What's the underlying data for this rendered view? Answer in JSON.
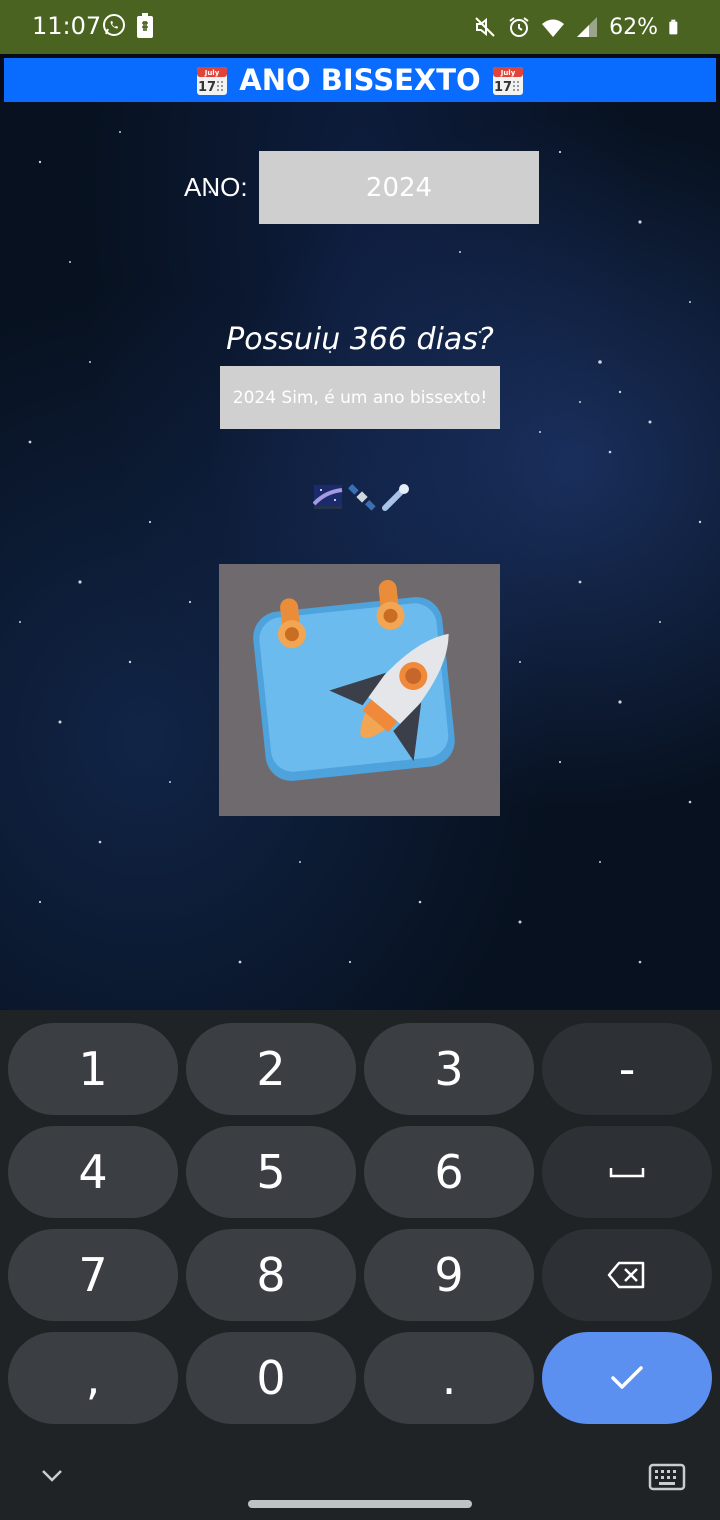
{
  "status_bar": {
    "time": "11:07",
    "battery_percent": "62%",
    "icons": [
      "whatsapp-icon",
      "sim-alert-icon",
      "mute-icon",
      "alarm-icon",
      "wifi-icon",
      "signal-icon",
      "battery-icon"
    ]
  },
  "app": {
    "title": "ANO BISSEXTO",
    "title_icon": "calendar-icon",
    "title_bar_color": "#0a6cff",
    "year_label": "ANO:",
    "year_value": "2024",
    "question": "Possuiu 366 dias?",
    "result": "2024 Sim, é um ano bissexto!",
    "emojis": [
      "milky-way-icon",
      "satellite-icon",
      "comet-icon"
    ],
    "illustration": "calendar-rocket-illustration"
  },
  "keyboard": {
    "rows": [
      [
        "1",
        "2",
        "3",
        "-"
      ],
      [
        "4",
        "5",
        "6",
        "space"
      ],
      [
        "7",
        "8",
        "9",
        "backspace"
      ],
      [
        ",",
        "0",
        ".",
        "enter"
      ]
    ],
    "accent_color": "#5b8ff0"
  }
}
